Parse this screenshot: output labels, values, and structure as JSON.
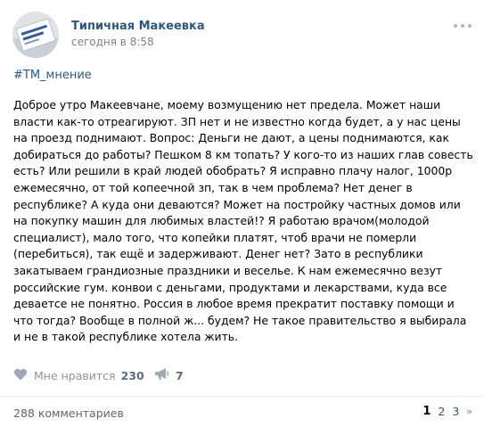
{
  "post": {
    "group_name": "Типичная Макеевка",
    "date": "сегодня в 8:58",
    "hashtag": "#ТМ_мнение",
    "text": "Доброе утро Макеевчане, моему возмущению нет предела. Может наши власти как-то отреагируют. ЗП нет и не известно когда будет, а у нас цены на проезд поднимают. Вопрос: Деньги не дают, а цены поднимаются, как добираться до работы? Пешком 8 км топать? У кого-то из наших глав совесть есть? Или решили в край людей обобрать? Я исправно плачу налог, 1000р ежемесячно, от той копеечной зп, так в чем проблема? Нет денег в республике? А куда они деваются? Может на постройку частных домов или на покупку машин для любимых властей!? Я работаю врачом(молодой специалист), мало того, что копейки платят, чтоб врачи не померли (перебиться), так ещё и задерживают. Денег нет? Зато в республики закатываем грандиозные праздники и веселье. К нам ежемесячно везут российские гум. конвои с деньгами, продуктами и лекарствами, куда все деваетсе не понятно. Россия в любое время прекратит поставку помощи и что тогда? Вообще в полной ж... будем? Не такое правительство я выбирала и не в такой республике хотела жить."
  },
  "actions": {
    "like_label": "Мне нравится",
    "like_count": "230",
    "share_count": "7",
    "like_icon": "heart-icon",
    "share_icon": "megaphone-icon"
  },
  "footer": {
    "comments_count": "288 комментариев",
    "pages": [
      "1",
      "2",
      "3"
    ],
    "next_glyph": "»"
  },
  "colors": {
    "link": "#2a5885",
    "muted": "#828282",
    "icon": "#9da9b9"
  }
}
